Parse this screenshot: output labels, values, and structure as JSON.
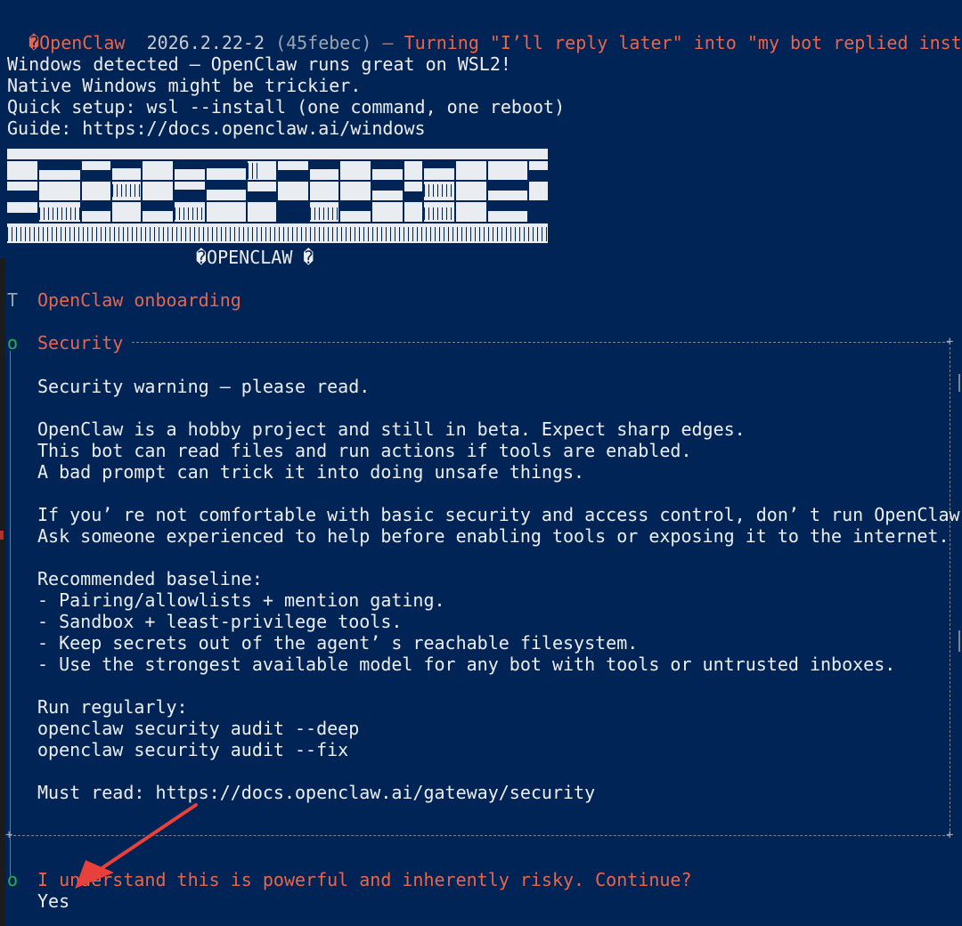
{
  "header": {
    "diamond": "�",
    "app_name": "OpenClaw",
    "version": "2026.2.22-2",
    "commit": "(45febec)",
    "tagline": "— Turning \"I’ll reply later\" into \"my bot replied instant"
  },
  "wsl_notice": [
    "Windows detected — OpenClaw runs great on WSL2!",
    "Native Windows might be trickier.",
    "Quick setup: wsl --install (one command, one reboot)",
    "Guide: https://docs.openclaw.ai/windows"
  ],
  "banner": {
    "caption": "�OPENCLAW �"
  },
  "onboarding": {
    "marker": "T",
    "title": "OpenClaw onboarding"
  },
  "security": {
    "marker": "o",
    "heading": "Security",
    "lines": [
      "Security warning — please read.",
      "",
      "OpenClaw is a hobby project and still in beta. Expect sharp edges.",
      "This bot can read files and run actions if tools are enabled.",
      "A bad prompt can trick it into doing unsafe things.",
      "",
      "If you’ re not comfortable with basic security and access control, don’ t run OpenClaw.",
      "Ask someone experienced to help before enabling tools or exposing it to the internet.",
      "",
      "Recommended baseline:",
      "- Pairing/allowlists + mention gating.",
      "- Sandbox + least-privilege tools.",
      "- Keep secrets out of the agent’ s reachable filesystem.",
      "- Use the strongest available model for any bot with tools or untrusted inboxes.",
      "",
      "Run regularly:",
      "openclaw security audit --deep",
      "openclaw security audit --fix",
      "",
      "Must read: https://docs.openclaw.ai/gateway/security"
    ]
  },
  "prompt": {
    "marker": "o",
    "question": "I understand this is powerful and inherently risky. Continue?",
    "answer": "Yes"
  },
  "colors": {
    "background": "#012456",
    "accent_orange": "#E8664C",
    "text": "#ECECEC",
    "marker_green": "#2FAE4F",
    "annotation_red": "#E8403A"
  }
}
